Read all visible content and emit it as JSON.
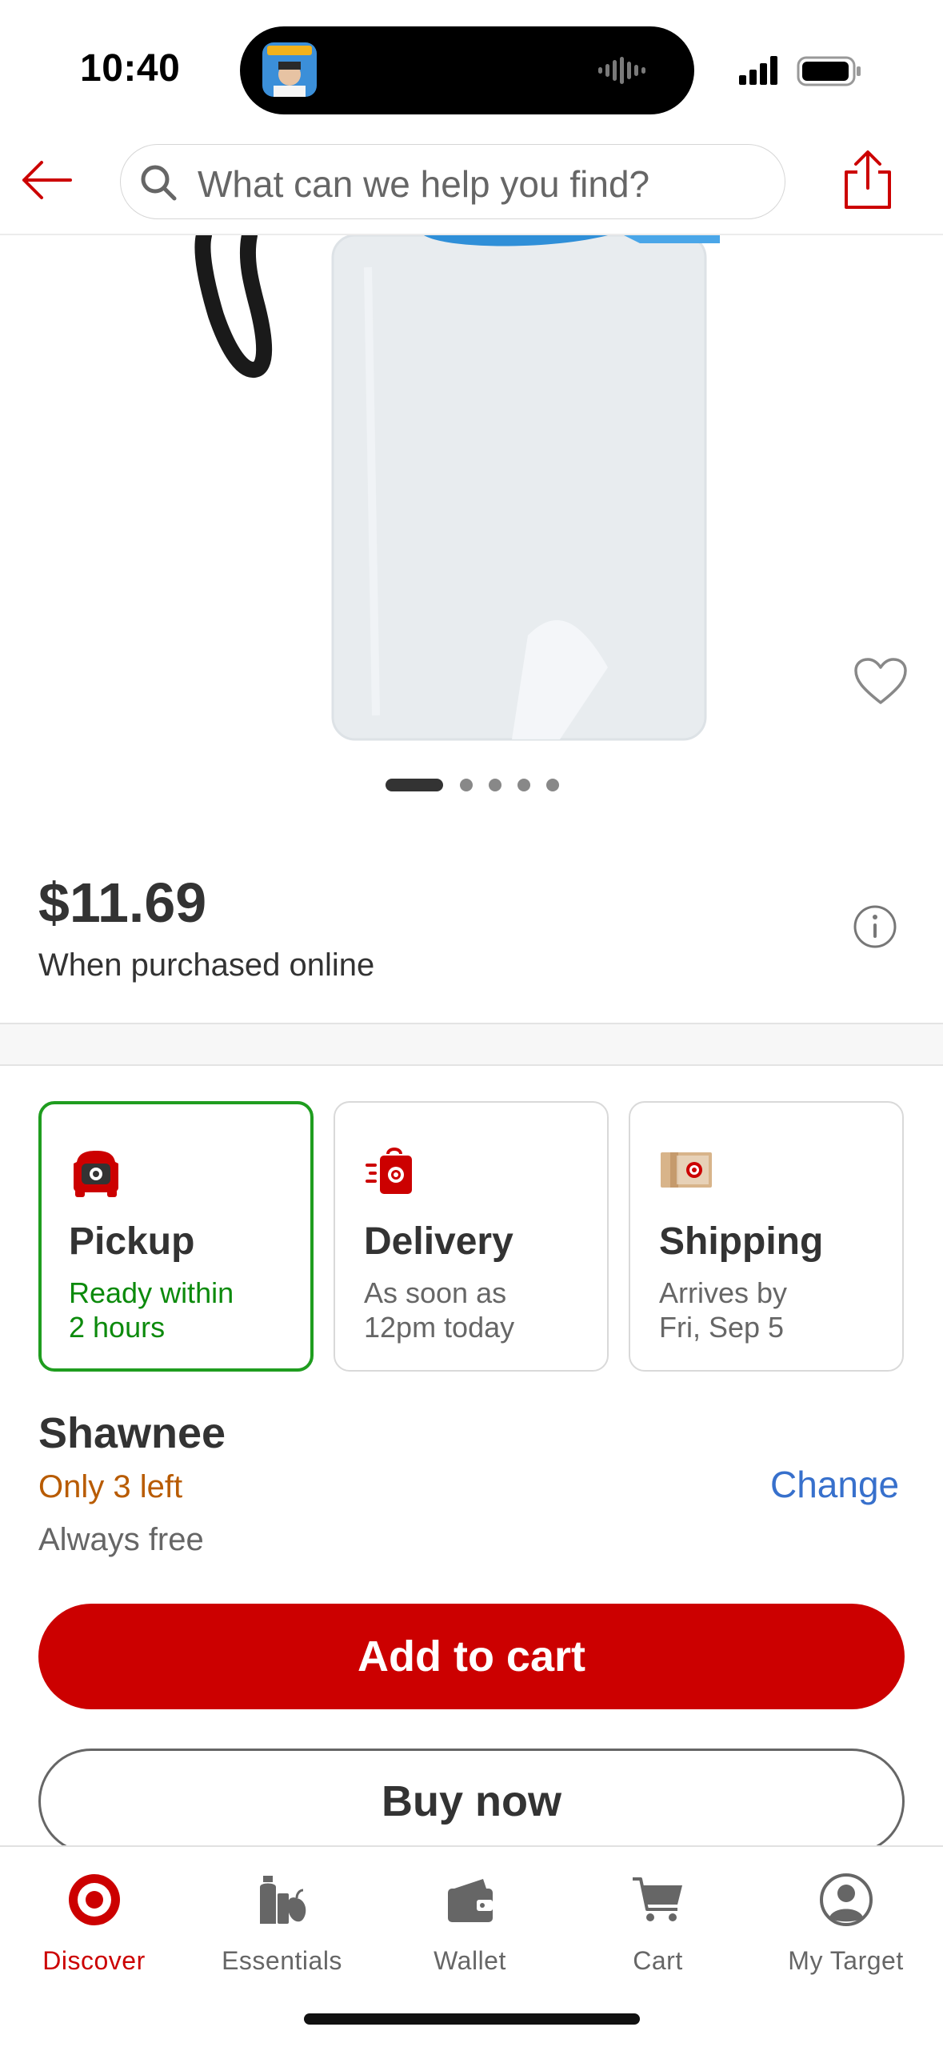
{
  "status_bar": {
    "time": "10:40"
  },
  "header": {
    "search_placeholder": "What can we help you find?"
  },
  "product": {
    "price": "$11.69",
    "price_note": "When purchased online",
    "image_pagination": {
      "total": 5,
      "current": 1
    }
  },
  "fulfillment": {
    "options": [
      {
        "title": "Pickup",
        "line1": "Ready within",
        "line2": "2 hours",
        "selected": true
      },
      {
        "title": "Delivery",
        "line1": "As soon as",
        "line2": "12pm today",
        "selected": false
      },
      {
        "title": "Shipping",
        "line1": "Arrives by",
        "line2": "Fri, Sep 5",
        "selected": false
      }
    ],
    "store": "Shawnee",
    "stock": "Only 3 left",
    "cost": "Always free",
    "change_label": "Change"
  },
  "actions": {
    "add_to_cart": "Add to cart",
    "buy_now": "Buy now"
  },
  "tab_bar": {
    "items": [
      {
        "label": "Discover",
        "icon": "target-logo-icon",
        "active": true
      },
      {
        "label": "Essentials",
        "icon": "essentials-icon",
        "active": false
      },
      {
        "label": "Wallet",
        "icon": "wallet-icon",
        "active": false
      },
      {
        "label": "Cart",
        "icon": "cart-icon",
        "active": false
      },
      {
        "label": "My Target",
        "icon": "account-icon",
        "active": false
      }
    ]
  },
  "colors": {
    "brand_red": "#cc0000",
    "pickup_green": "#1f9d1f",
    "stock_orange": "#b85b00",
    "link_blue": "#3770cc"
  }
}
